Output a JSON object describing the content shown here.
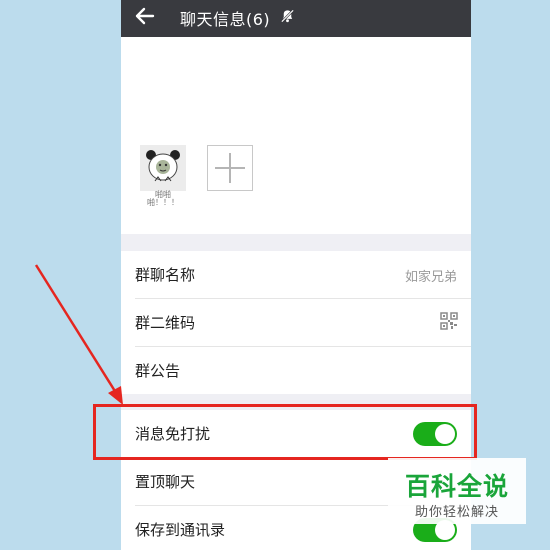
{
  "header": {
    "title": "聊天信息(6)"
  },
  "members": {
    "member_caption": "啪啪啪！！！"
  },
  "group_info": {
    "name_label": "群聊名称",
    "name_value": "如家兄弟",
    "qrcode_label": "群二维码",
    "announcement_label": "群公告"
  },
  "settings": {
    "mute_label": "消息免打扰",
    "mute_on": true,
    "pin_label": "置顶聊天",
    "save_label": "保存到通讯录"
  },
  "watermark": {
    "main": "百科全说",
    "sub": "助你轻松解决"
  },
  "colors": {
    "accent": "#1aad19",
    "annotation": "#e52620",
    "titlebar": "#393a3f"
  }
}
